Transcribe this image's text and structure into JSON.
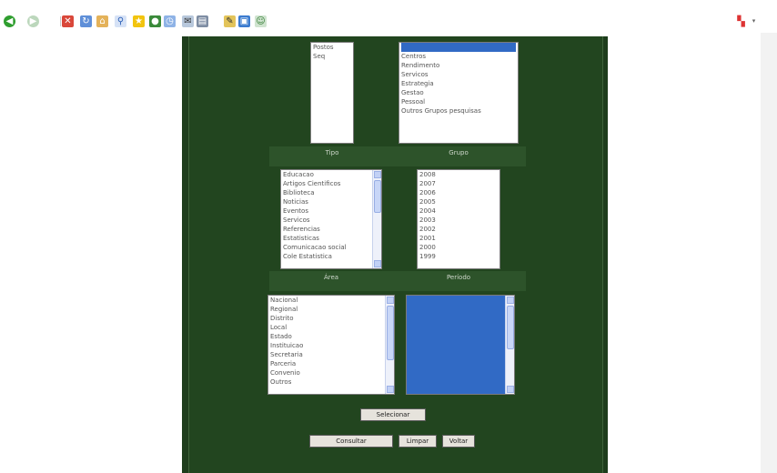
{
  "toolbar": {
    "icons": [
      "back-icon",
      "forward-icon",
      "stop-icon",
      "refresh-icon",
      "home-icon",
      "search-icon",
      "favorites-icon",
      "media-icon",
      "history-icon",
      "mail-icon",
      "print-icon",
      "edit-icon",
      "discuss-icon",
      "messenger-icon",
      "research-icon"
    ]
  },
  "page": {
    "lists": {
      "tipo": {
        "label": "Tipo",
        "items": [
          "Postos",
          "Seq"
        ]
      },
      "grupo": {
        "label": "Grupo",
        "items": [
          "",
          "Centros",
          "Rendimento",
          "Servicos",
          "Estrategia",
          "Gestao",
          "Pessoal",
          "Outros Grupos pesquisas"
        ]
      },
      "area": {
        "label": "Área",
        "items": [
          "Educacao",
          "Artigos Cientificos",
          "Biblioteca",
          "Noticias",
          "Eventos",
          "Servicos",
          "Referencias",
          "Estatisticas",
          "Comunicacao social",
          "Cole Estatistica"
        ]
      },
      "periodo": {
        "label": "Período",
        "items": [
          "2008",
          "2007",
          "2006",
          "2005",
          "2004",
          "2003",
          "2002",
          "2001",
          "2000",
          "1999"
        ]
      },
      "origem": {
        "items": [
          "Nacional",
          "Regional",
          "Distrito",
          "Local",
          "Estado",
          "Instituicao",
          "Secretaria",
          "Parceria",
          "Convenio",
          "Outros"
        ]
      },
      "destino": {
        "items": [
          "",
          "",
          "",
          "",
          "",
          "",
          "",
          "",
          "",
          ""
        ]
      }
    },
    "buttons": {
      "selecionar": "Selecionar",
      "consultar": "Consultar",
      "limpar": "Limpar",
      "voltar": "Voltar"
    }
  }
}
